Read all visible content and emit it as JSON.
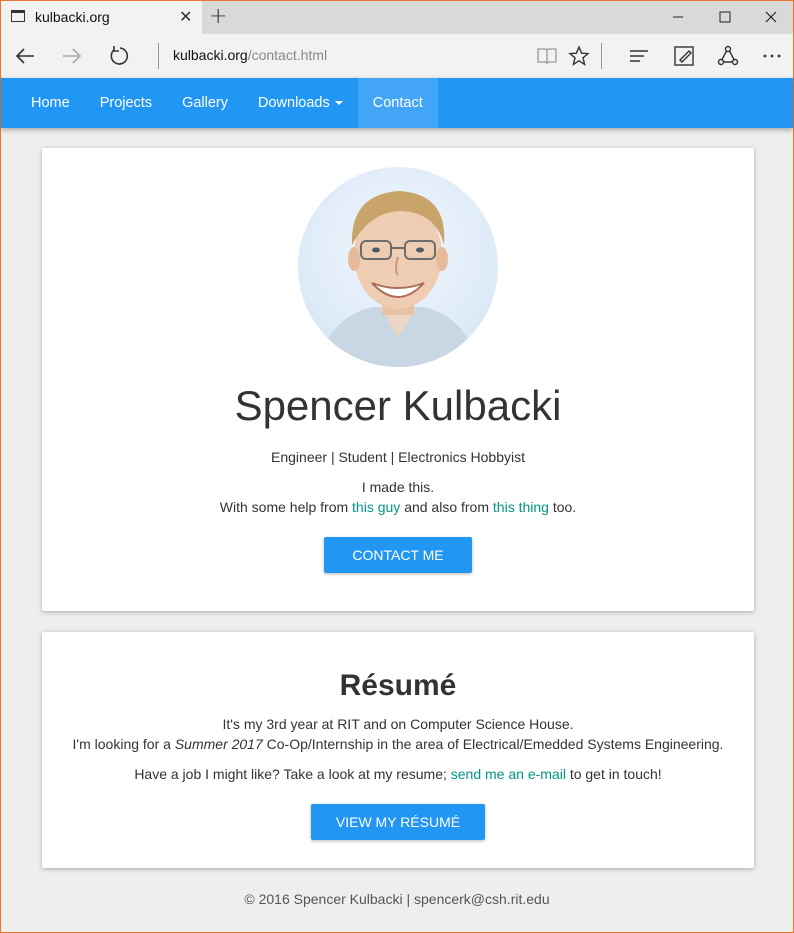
{
  "browser": {
    "tab_title": "kulbacki.org",
    "url_domain": "kulbacki.org",
    "url_path": "/contact.html"
  },
  "nav": {
    "items": [
      {
        "label": "Home"
      },
      {
        "label": "Projects"
      },
      {
        "label": "Gallery"
      },
      {
        "label": "Downloads"
      },
      {
        "label": "Contact"
      }
    ]
  },
  "profile": {
    "name": "Spencer Kulbacki",
    "tagline": "Engineer | Student | Electronics Hobbyist",
    "made_this": "I made this.",
    "help_prefix": "With some help from",
    "help_link1": "this guy",
    "help_mid": "and also from",
    "help_link2": "this thing",
    "help_suffix": "too.",
    "contact_button": "Contact Me"
  },
  "resume": {
    "title": "Résumé",
    "line1": "It's my 3rd year at RIT and on Computer Science House.",
    "line2_prefix": "I'm looking for a",
    "line2_em": "Summer 2017",
    "line2_suffix": "Co-Op/Internship in the area of Electrical/Emedded Systems Engineering.",
    "line3_prefix": "Have a job I might like? Take a look at my resume;",
    "line3_link": "send me an e-mail",
    "line3_suffix": "to get in touch!",
    "button": "View My Résumé"
  },
  "footer": {
    "text": "© 2016 Spencer Kulbacki | spencerk@csh.rit.edu"
  },
  "colors": {
    "primary": "#2196f3",
    "link": "#009688",
    "background": "#eeeeee"
  }
}
